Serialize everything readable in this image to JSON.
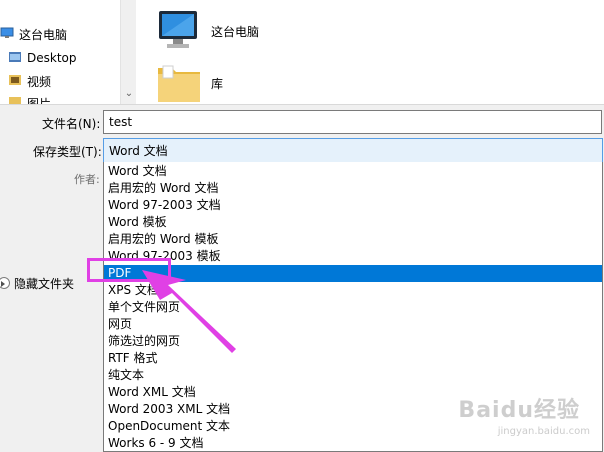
{
  "nav": {
    "items": [
      {
        "label": "这台电脑",
        "icon": "computer-icon"
      },
      {
        "label": "Desktop",
        "icon": "folder-icon"
      },
      {
        "label": "视频",
        "icon": "video-folder-icon"
      },
      {
        "label": "图片",
        "icon": "picture-folder-icon"
      }
    ]
  },
  "content": {
    "items": [
      {
        "label": "这台电脑",
        "icon": "computer-icon"
      },
      {
        "label": "库",
        "icon": "library-icon"
      }
    ]
  },
  "form": {
    "filename_label": "文件名(N):",
    "filename_value": "test",
    "filetype_label": "保存类型(T):",
    "filetype_value": "Word 文档",
    "author_label": "作者:",
    "hide_folders_label": "隐藏文件夹"
  },
  "dropdown": {
    "options": [
      "Word 文档",
      "启用宏的 Word 文档",
      "Word 97-2003 文档",
      "Word 模板",
      "启用宏的 Word 模板",
      "Word 97-2003 模板",
      "PDF",
      "XPS 文档",
      "单个文件网页",
      "网页",
      "筛选过的网页",
      "RTF 格式",
      "纯文本",
      "Word XML 文档",
      "Word 2003 XML 文档",
      "OpenDocument 文本",
      "Works 6 - 9 文档"
    ],
    "selected_index": 6
  },
  "watermark": {
    "text": "Baidu经验",
    "url": "jingyan.baidu.com"
  },
  "colors": {
    "selection": "#0078d7",
    "annotation": "#e040e5"
  }
}
